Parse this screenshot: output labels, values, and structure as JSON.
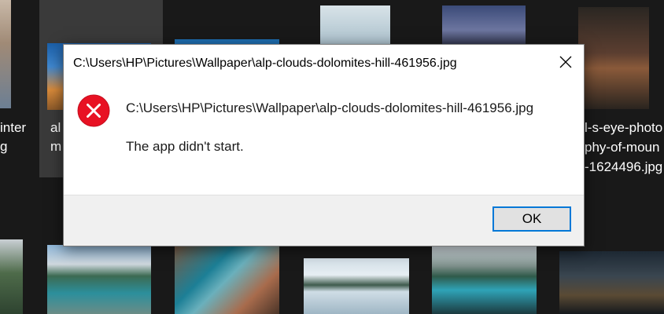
{
  "background": {
    "labels": {
      "left_line1": "inter",
      "left_line2": "g",
      "mid_line1": "al",
      "mid_line2": "m",
      "right_line1": "l-s-eye-photo",
      "right_line2": "phy-of-moun",
      "right_line3": "-1624496.jpg"
    }
  },
  "dialog": {
    "title": "C:\\Users\\HP\\Pictures\\Wallpaper\\alp-clouds-dolomites-hill-461956.jpg",
    "path": "C:\\Users\\HP\\Pictures\\Wallpaper\\alp-clouds-dolomites-hill-461956.jpg",
    "message": "The app didn't start.",
    "ok_label": "OK",
    "icons": {
      "close": "close-icon",
      "status": "error-icon"
    }
  },
  "colors": {
    "error_red": "#e81123",
    "accent_blue": "#0078d7",
    "backdrop": "#191919"
  }
}
